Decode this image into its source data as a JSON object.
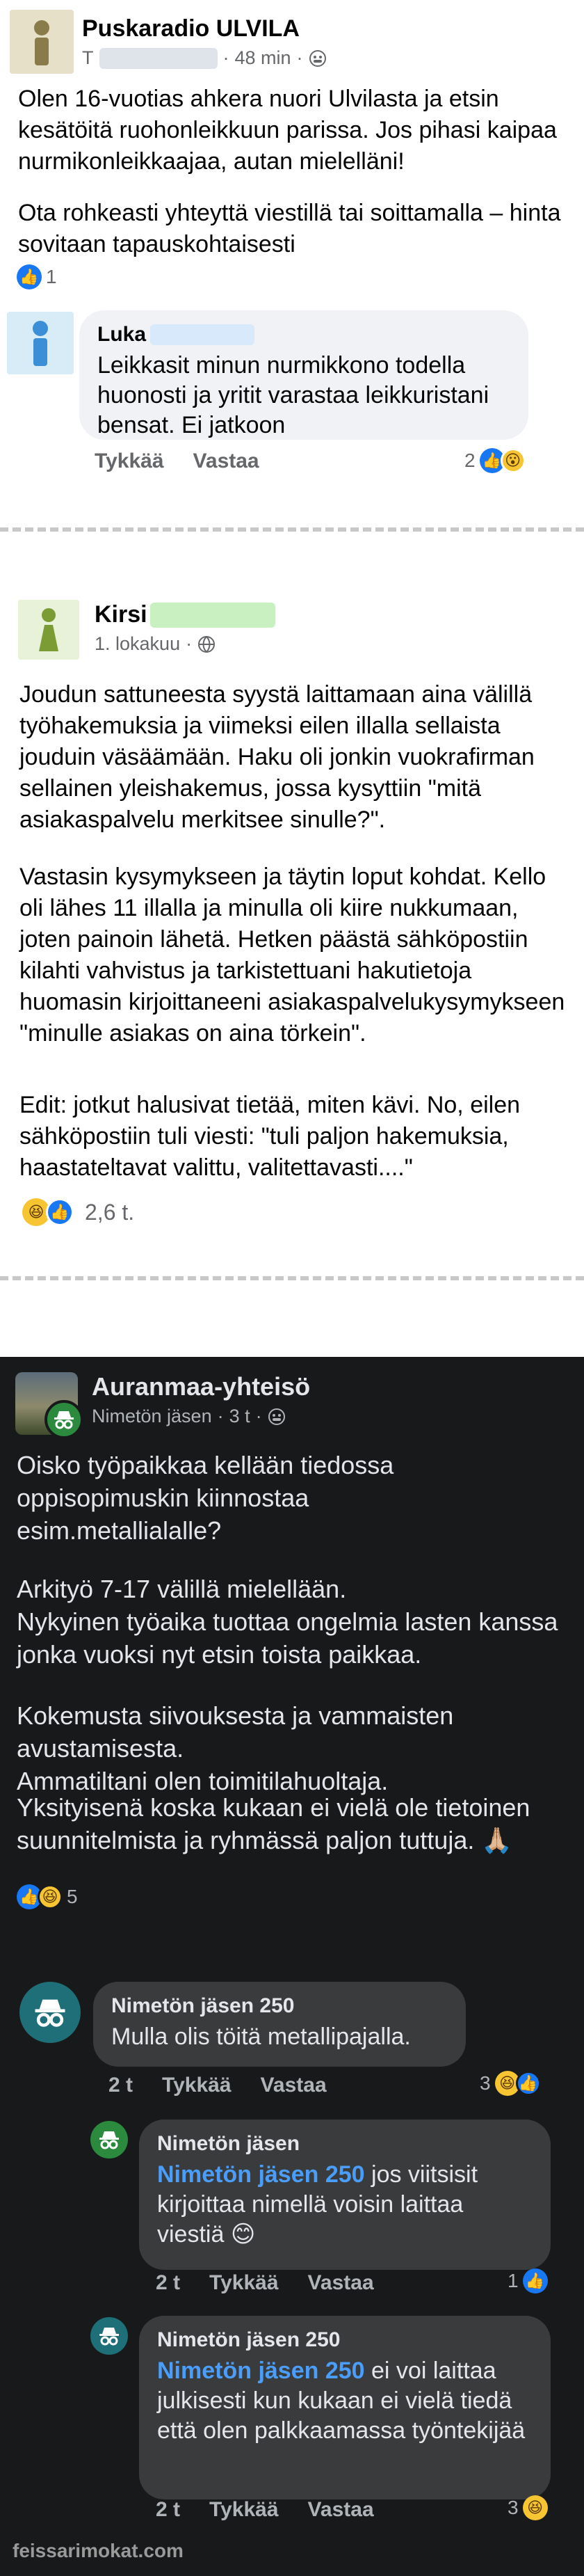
{
  "post1": {
    "author": "Puskaradio ULVILA",
    "author_prefix": "T",
    "time": "48 min",
    "text": "Olen 16-vuotias ahkera nuori Ulvilasta ja etsin kesätöitä ruohonleikkuun parissa. Jos pihasi kaipaa nurmikonleikkaajaa, autan mielelläni!",
    "text2": "Ota rohkeasti yhteyttä viestillä tai soittamalla – hinta sovitaan tapauskohtaisesti",
    "reactions": "1",
    "comment": {
      "author": "Luka",
      "text": "Leikkasit minun nurmikkono todella huonosti ja yritit varastaa leikkuristani bensat. Ei jatkoon",
      "like_label": "Tykkää",
      "reply_label": "Vastaa",
      "reactions": "2"
    }
  },
  "post2": {
    "author": "Kirsi",
    "time": "1. lokakuu",
    "para1": "Joudun sattuneesta syystä laittamaan aina välillä työhakemuksia ja viimeksi eilen illalla sellaista jouduin väsäämään. Haku oli jonkin vuokrafirman sellainen yleishakemus, jossa kysyttiin \"mitä asiakaspalvelu merkitsee sinulle?\".",
    "para2": "Vastasin kysymykseen ja täytin loput kohdat. Kello oli lähes 11 illalla ja minulla oli kiire nukkumaan, joten painoin lähetä. Hetken päästä sähköpostiin kilahti vahvistus ja tarkistettuani hakutietoja huomasin kirjoittaneeni asiakaspalvelukysymykseen \"minulle asiakas on aina törkein\".",
    "para3": "Edit: jotkut halusivat tietää, miten kävi. No, eilen sähköpostiin tuli viesti: \"tuli paljon hakemuksia, haastateltavat valittu, valitettavasti....\"",
    "reactions": "2,6 t."
  },
  "post3": {
    "group": "Auranmaa-yhteisö",
    "author": "Nimetön jäsen",
    "time": "3 t",
    "para1": "Oisko työpaikkaa kellään tiedossa oppisopimuskin kiinnostaa esim.metallialalle?",
    "para2": "Arkityö 7-17 välillä mielellään.\nNykyinen työaika tuottaa ongelmia lasten kanssa jonka vuoksi nyt etsin toista paikkaa.",
    "para3": "Kokemusta siivouksesta ja vammaisten avustamisesta.\nAmmatiltani olen toimitilahuoltaja.",
    "para4": "Yksityisenä koska kukaan ei vielä ole tietoinen suunnitelmista ja ryhmässä paljon tuttuja. 🙏🏼",
    "reactions": "5",
    "comments": [
      {
        "author": "Nimetön jäsen 250",
        "text": "Mulla olis töitä metallipajalla.",
        "time": "2 t",
        "like_label": "Tykkää",
        "reply_label": "Vastaa",
        "reactions": "3"
      },
      {
        "author": "Nimetön jäsen",
        "mention": "Nimetön jäsen 250",
        "text": " jos viitsisit kirjoittaa nimellä voisin laittaa viestiä 😊",
        "time": "2 t",
        "like_label": "Tykkää",
        "reply_label": "Vastaa",
        "reactions": "1"
      },
      {
        "author": "Nimetön jäsen 250",
        "mention": "Nimetön jäsen 250",
        "text": " ei voi laittaa julkisesti kun kukaan ei vielä tiedä että olen palkkaamassa työntekijää",
        "time": "2 t",
        "like_label": "Tykkää",
        "reply_label": "Vastaa",
        "reactions": "3"
      }
    ]
  },
  "watermark": "feissarimokat.com",
  "icons": {
    "globe": "globe-icon",
    "like": "like-reaction-icon",
    "haha": "haha-reaction-icon",
    "wow": "wow-reaction-icon",
    "anonymous": "anonymous-member-icon"
  },
  "colors": {
    "like_blue": "#1877f2",
    "mention_blue": "#4a9df8",
    "dark_bg": "#18191a",
    "anon_green": "#2b8a3e",
    "anon_teal": "#1f6f78"
  }
}
